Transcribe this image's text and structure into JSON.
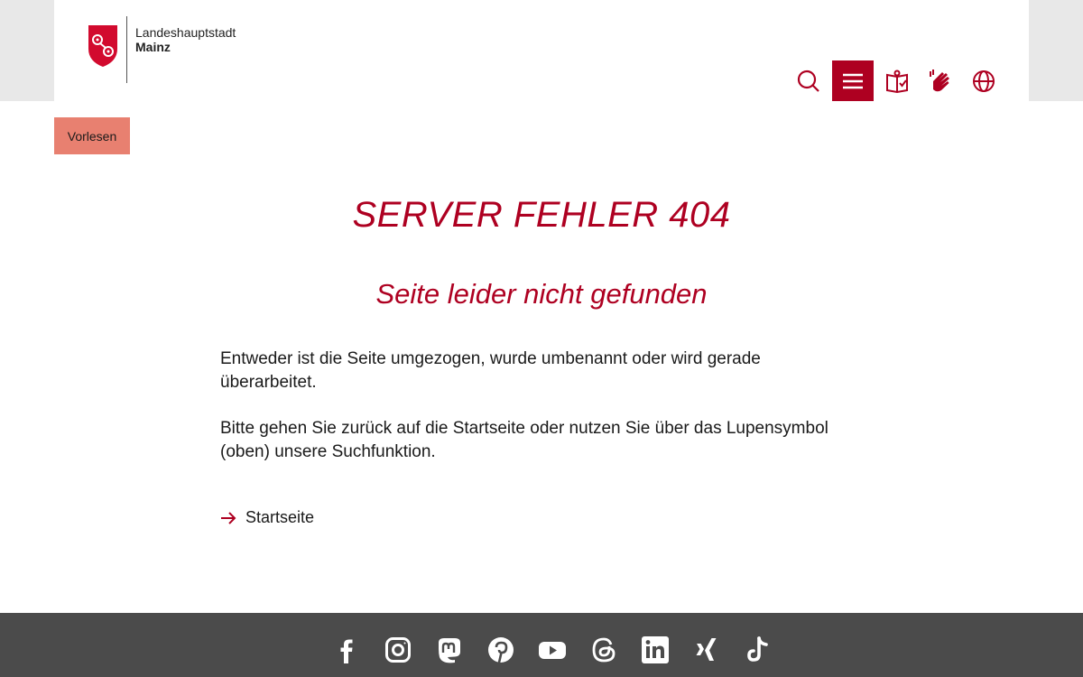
{
  "header": {
    "logo_line1": "Landeshauptstadt",
    "logo_line2": "Mainz",
    "tools": [
      "search-icon",
      "menu-icon",
      "easy-language-icon",
      "sign-language-icon",
      "globe-icon"
    ]
  },
  "colors": {
    "brand_red": "#ae0021",
    "vorlesen_bg": "#e88070",
    "footer_bg": "#4b4b4b",
    "header_band": "#e8e8e8"
  },
  "vorlesen_label": "Vorlesen",
  "main": {
    "title": "SERVER FEHLER 404",
    "subtitle": "Seite leider nicht gefunden",
    "paragraph1": "Entweder ist die Seite umgezogen, wurde umbenannt oder wird gerade überarbeitet.",
    "paragraph2": "Bitte gehen Sie zurück auf die Startseite oder nutzen Sie über das Lupensymbol (oben) unsere Suchfunktion.",
    "link_label": "Startseite"
  },
  "footer": {
    "social_icons": [
      "facebook-icon",
      "instagram-icon",
      "mastodon-icon",
      "pinterest-icon",
      "youtube-icon",
      "threads-icon",
      "linkedin-icon",
      "xing-icon",
      "tiktok-icon"
    ]
  }
}
